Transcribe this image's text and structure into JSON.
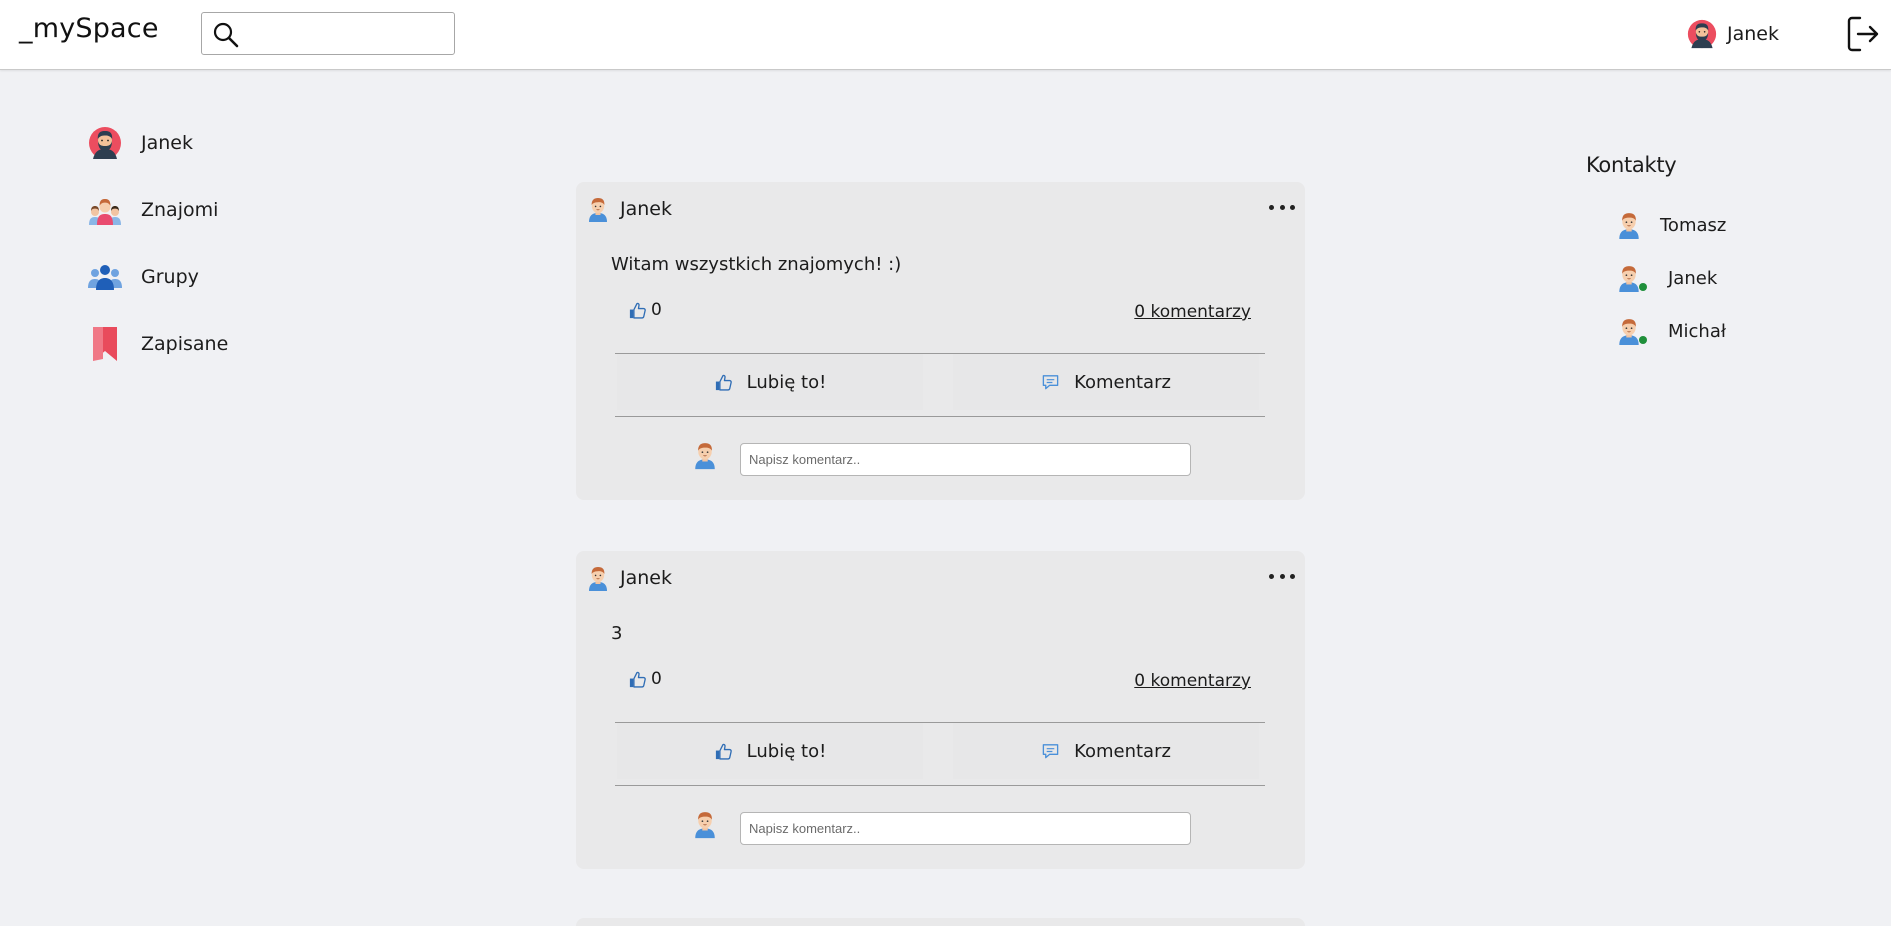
{
  "header": {
    "logo": "_mySpace",
    "search_placeholder": "",
    "user_name": "Janek"
  },
  "sidebar": {
    "items": [
      {
        "label": "Janek",
        "icon": "user-avatar-icon"
      },
      {
        "label": "Znajomi",
        "icon": "friends-icon"
      },
      {
        "label": "Grupy",
        "icon": "groups-icon"
      },
      {
        "label": "Zapisane",
        "icon": "bookmark-icon"
      }
    ]
  },
  "posts": [
    {
      "author": "Janek",
      "content": "Witam wszystkich znajomych! :)",
      "likes": "0",
      "comments_link": "0 komentarzy",
      "like_label": "Lubię to!",
      "comment_label": "Komentarz",
      "comment_placeholder": "Napisz komentarz.."
    },
    {
      "author": "Janek",
      "content": "3",
      "likes": "0",
      "comments_link": "0 komentarzy",
      "like_label": "Lubię to!",
      "comment_label": "Komentarz",
      "comment_placeholder": "Napisz komentarz.."
    }
  ],
  "contacts": {
    "title": "Kontakty",
    "items": [
      {
        "name": "Tomasz",
        "online": false
      },
      {
        "name": "Janek",
        "online": true
      },
      {
        "name": "Michał",
        "online": true
      }
    ]
  },
  "colors": {
    "online": "#1f8f3a",
    "like_blue": "#2f6db5",
    "bookmark": "#e94b5c"
  }
}
